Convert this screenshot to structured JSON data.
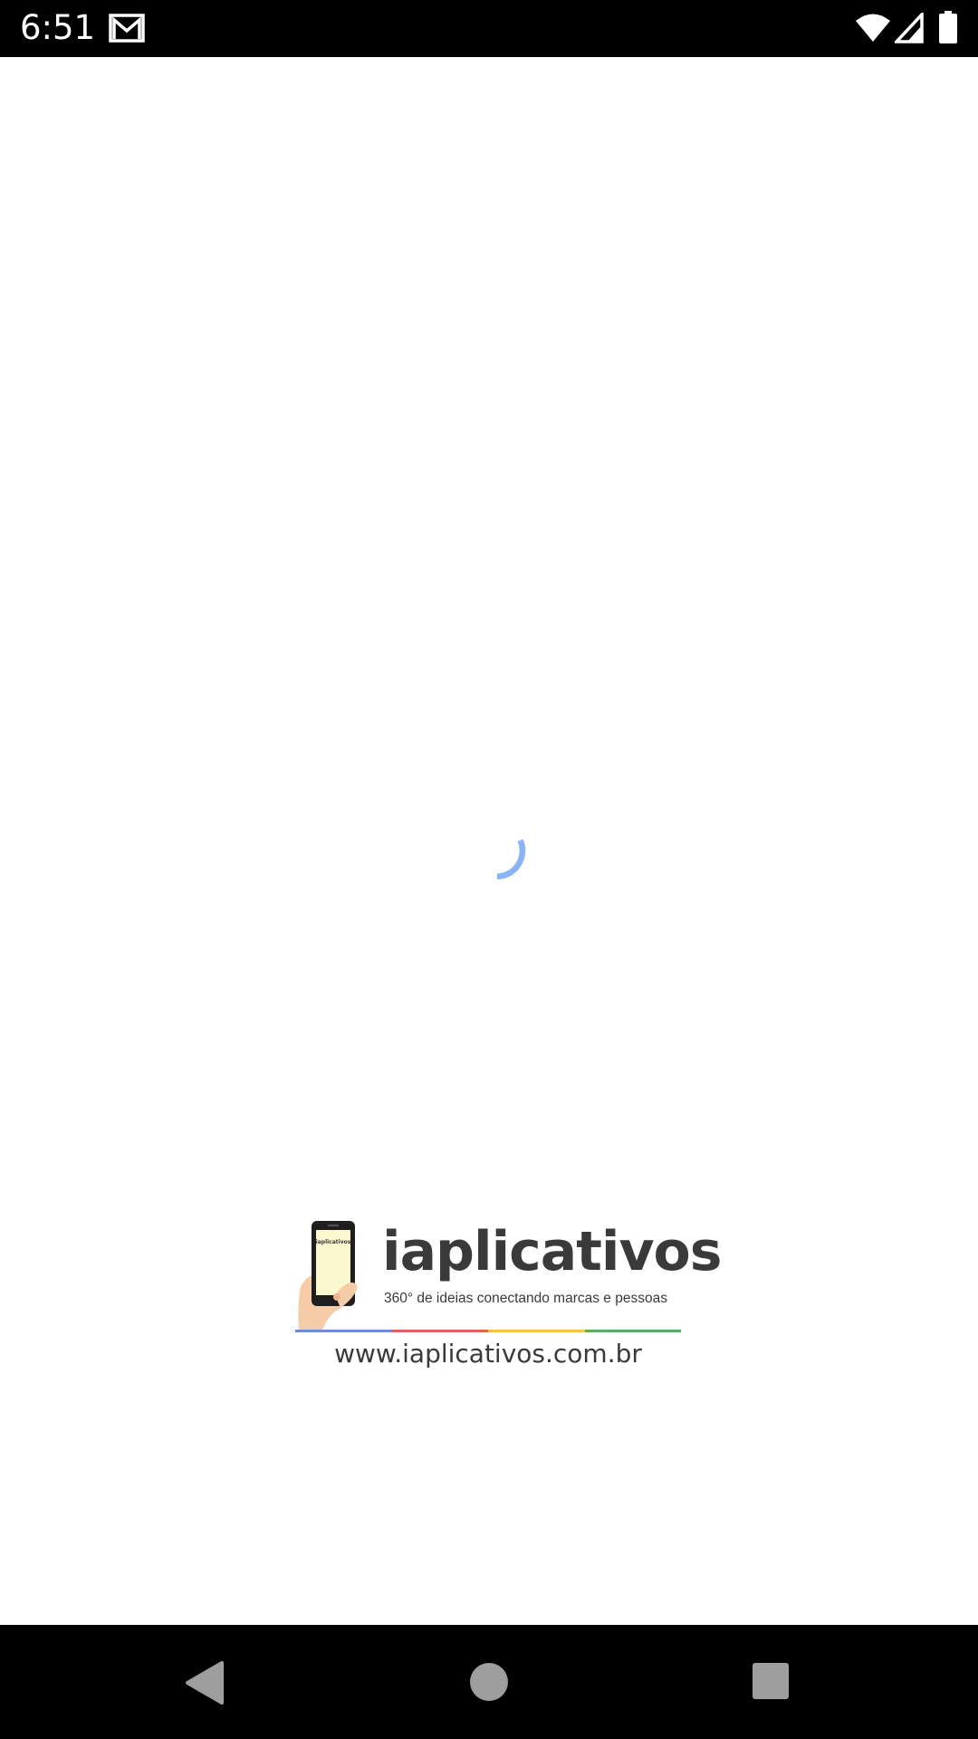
{
  "status_bar": {
    "time": "6:51",
    "icons": [
      "gmail-icon",
      "wifi-icon",
      "cell-signal-icon",
      "battery-icon"
    ]
  },
  "loading": {
    "indicator": "spinner-icon",
    "color": "#8ab4f8"
  },
  "branding": {
    "name": "iaplicativos",
    "tagline": "360° de ideias conectando marcas e pessoas",
    "url": "www.iaplicativos.com.br",
    "phone_screen_text": "iaplicativos",
    "rule_colors": [
      "#6b8fd6",
      "#e0635a",
      "#f2c744",
      "#5aae5e"
    ],
    "text_color": "#3a3a3a"
  },
  "nav_bar": {
    "buttons": [
      "back-icon",
      "home-icon",
      "recents-icon"
    ]
  }
}
